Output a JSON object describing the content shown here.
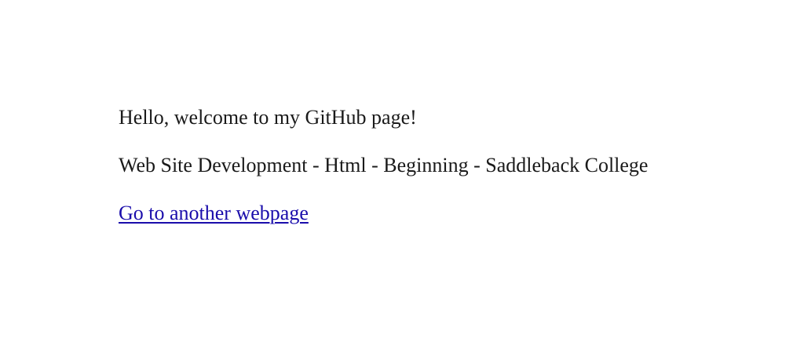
{
  "page": {
    "greeting": "Hello, welcome to my GitHub page!",
    "course": "Web Site Development - Html - Beginning - Saddleback College",
    "link_text": "Go to another webpage"
  },
  "colors": {
    "text": "#1a1a1a",
    "link": "#1a0dab",
    "background": "#ffffff"
  }
}
